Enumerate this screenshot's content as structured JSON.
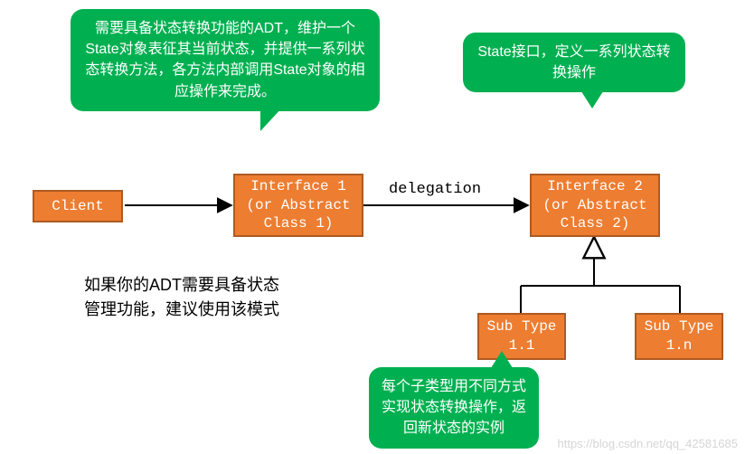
{
  "nodes": {
    "client": "Client",
    "interface1": "Interface 1\n(or Abstract\nClass 1)",
    "interface2": "Interface 2\n(or Abstract\nClass 2)",
    "subtype11": "Sub Type\n1.1",
    "subtype1n": "Sub Type\n1.n"
  },
  "edges": {
    "delegation_label": "delegation"
  },
  "bubbles": {
    "adt_desc": "需要具备状态转换功能的ADT，维护一个State对象表征其当前状态，并提供一系列状态转换方法，各方法内部调用State对象的相应操作来完成。",
    "state_desc": "State接口，定义一系列状态转换操作",
    "subtype_desc": "每个子类型用不同方式实现状态转换操作，返回新状态的实例"
  },
  "note": "如果你的ADT需要具备状态管理功能，建议使用该模式",
  "watermark": "https://blog.csdn.net/qq_42581685"
}
